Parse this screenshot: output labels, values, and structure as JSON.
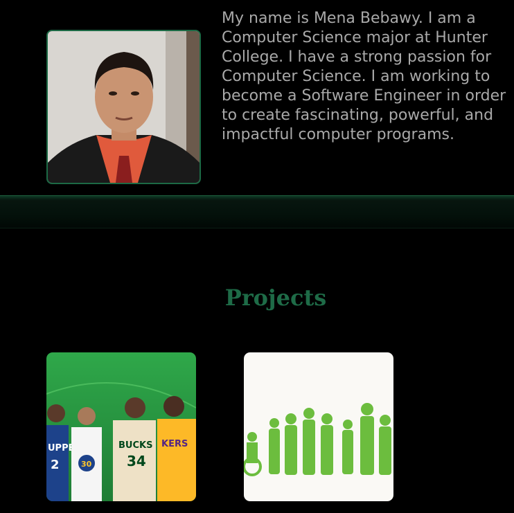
{
  "profile": {
    "photo_alt": "Photo of Mena Bebawy",
    "bio_lines": [
      "My name is Mena Bebawy. I am a",
      "Computer Science major at Hunter",
      "College. I have a strong passion for",
      "Computer Science. I am working to",
      "become a Software Engineer in order",
      "to create fascinating, powerful, and",
      "impactful computer programs."
    ]
  },
  "projects": {
    "heading": "Projects",
    "cards": [
      {
        "name": "basketball-project",
        "jersey_texts": [
          "UPPE",
          "2",
          "30",
          "BUCKS",
          "34",
          "KERS"
        ]
      },
      {
        "name": "people-silhouettes-project"
      }
    ]
  },
  "colors": {
    "background": "#000000",
    "accent_green": "#1e6b47",
    "bio_text": "#a9a9a9",
    "silhouette_green": "#6cbd3e"
  }
}
